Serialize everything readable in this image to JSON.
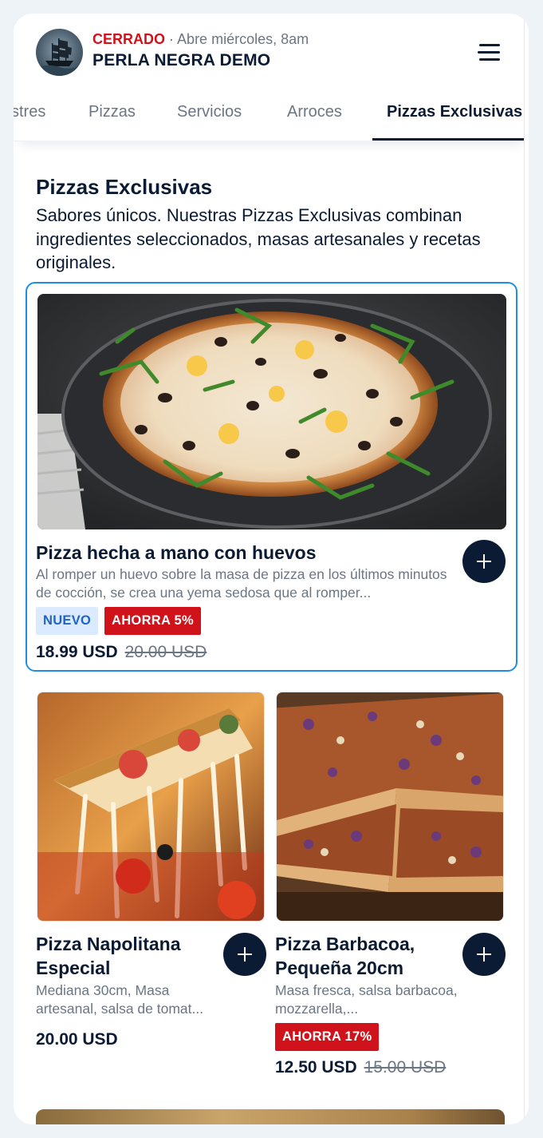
{
  "header": {
    "status_closed": "CERRADO",
    "status_separator": "·",
    "status_open": "Abre miércoles, 8am",
    "store_name": "PERLA NEGRA DEMO"
  },
  "tabs": [
    {
      "label": "stres"
    },
    {
      "label": "Pizzas"
    },
    {
      "label": "Servicios"
    },
    {
      "label": "Arroces"
    },
    {
      "label": "Pizzas Exclusivas",
      "active": true
    }
  ],
  "section": {
    "title": "Pizzas Exclusivas",
    "description": "Sabores únicos. Nuestras Pizzas Exclusivas combinan ingredientes seleccionados, masas artesanales y recetas originales."
  },
  "products": [
    {
      "name": "Pizza hecha a mano con huevos",
      "description": "Al romper un huevo sobre la masa de pizza en los últimos minutos de cocción, se crea una yema sedosa que al romper...",
      "badges": [
        "NUEVO",
        "AHORRA 5%"
      ],
      "price": "18.99 USD",
      "old_price": "20.00 USD",
      "image": "pizza-eggs-arugula-photo"
    },
    {
      "name": "Pizza Napolitana Especial",
      "description": "Mediana 30cm, Masa artesanal, salsa de tomat...",
      "badges": [],
      "price": "20.00 USD",
      "image": "pizza-cheese-pull-photo"
    },
    {
      "name": "Pizza Barbacoa, Pequeña 20cm",
      "description": "Masa fresca, salsa barbacoa, mozzarella,...",
      "badges": [
        "AHORRA 17%"
      ],
      "price": "12.50 USD",
      "old_price": "15.00 USD",
      "image": "pizza-bbq-photo"
    }
  ],
  "icons": {
    "menu": "hamburger-menu-icon",
    "add": "plus-icon",
    "logo": "pirate-ship-logo"
  },
  "colors": {
    "accent_dark": "#0b1b33",
    "closed_red": "#d0121b",
    "selected_border": "#1e8fe0",
    "badge_new_bg": "#dbeafe",
    "badge_new_text": "#1f63c6",
    "muted_text": "#6b7684"
  }
}
